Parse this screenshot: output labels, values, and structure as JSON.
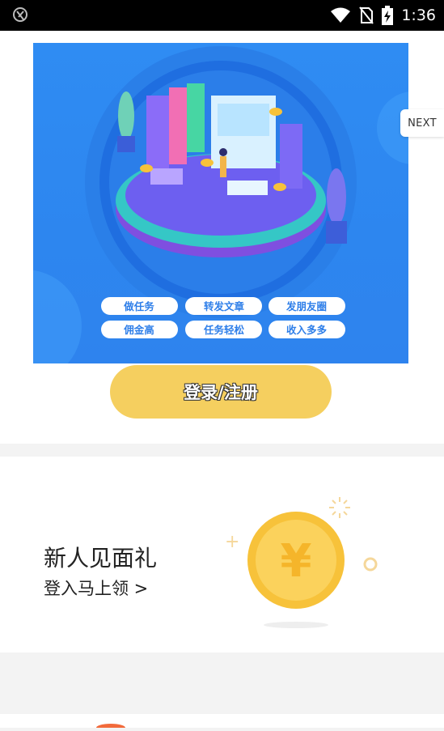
{
  "status_bar": {
    "time": "1:36",
    "icons": [
      "notification-app-icon",
      "wifi-icon",
      "no-sim-icon",
      "battery-charging-icon"
    ]
  },
  "banner": {
    "tags": [
      "做任务",
      "转发文章",
      "发朋友圈",
      "佣金高",
      "任务轻松",
      "收入多多"
    ],
    "next_label": "NEXT"
  },
  "login": {
    "button_label": "登录/注册"
  },
  "gift": {
    "title": "新人见面礼",
    "subtitle": "登入马上领 >",
    "coin_symbol": "¥"
  },
  "colors": {
    "banner_blue": "#2f8cf3",
    "login_yellow": "#f5cf5f",
    "coin_gold": "#f7c23a"
  }
}
